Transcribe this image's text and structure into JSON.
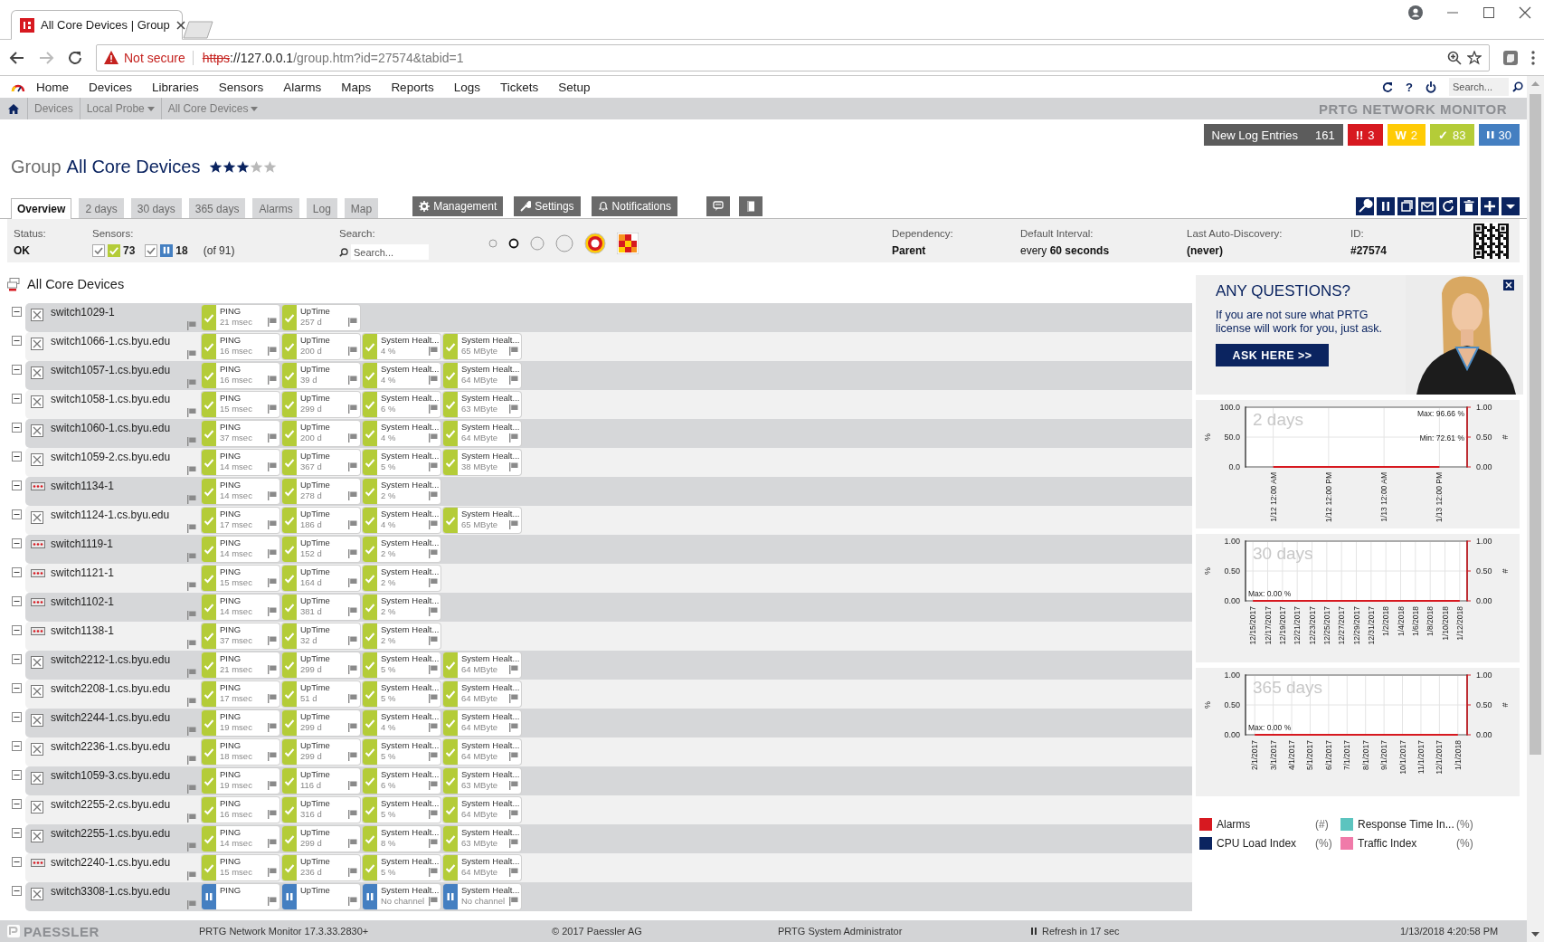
{
  "browser": {
    "tab": {
      "title": "All Core Devices | Group"
    },
    "not_secure": "Not secure",
    "url": {
      "scheme": "https",
      "host": "://127.0.0.1",
      "path": "/group.htm?id=27574&tabid=1"
    }
  },
  "menu": {
    "items": [
      "Home",
      "Devices",
      "Libraries",
      "Sensors",
      "Alarms",
      "Maps",
      "Reports",
      "Logs",
      "Tickets",
      "Setup"
    ],
    "help": "?",
    "search": {
      "placeholder": "Search..."
    }
  },
  "breadcrumb": {
    "items": [
      {
        "label": "Devices",
        "dropdown": false
      },
      {
        "label": "Local Probe",
        "dropdown": true
      },
      {
        "label": "All Core Devices",
        "dropdown": true
      }
    ],
    "product": "PRTG NETWORK MONITOR"
  },
  "badges": [
    {
      "kind": "log",
      "label": "New Log Entries",
      "count": "161",
      "color": "#5c5c5c"
    },
    {
      "kind": "down",
      "symbol": "!!",
      "count": "3",
      "color": "#d71920"
    },
    {
      "kind": "warning",
      "symbol": "W",
      "count": "2",
      "color": "#ffcb05"
    },
    {
      "kind": "up",
      "symbol": "✓",
      "count": "83",
      "color": "#b4cc38"
    },
    {
      "kind": "paused",
      "count": "30",
      "color": "#447fc1"
    }
  ],
  "page": {
    "type": "Group",
    "title": "All Core Devices",
    "stars": 3
  },
  "tabs": [
    {
      "label": "Overview",
      "selected": true
    },
    {
      "label": "2 days",
      "selected": false
    },
    {
      "label": "30 days",
      "selected": false
    },
    {
      "label": "365 days",
      "selected": false
    },
    {
      "label": "Alarms",
      "selected": false
    },
    {
      "label": "Log",
      "selected": false
    },
    {
      "label": "Map",
      "selected": false
    }
  ],
  "actions": [
    {
      "kind": "management",
      "label": "Management"
    },
    {
      "kind": "settings",
      "label": "Settings"
    },
    {
      "kind": "notifications",
      "label": "Notifications"
    },
    {
      "kind": "comments"
    },
    {
      "kind": "history"
    }
  ],
  "toolbar": [
    {
      "kind": "edit"
    },
    {
      "kind": "pause"
    },
    {
      "kind": "clone"
    },
    {
      "kind": "email"
    },
    {
      "kind": "rescan"
    },
    {
      "kind": "delete"
    },
    {
      "kind": "add"
    },
    {
      "kind": "more"
    }
  ],
  "info": {
    "status": {
      "label": "Status:",
      "value": "OK"
    },
    "sensors": {
      "label": "Sensors:",
      "filters": [
        {
          "kind": "up",
          "checked": true,
          "count": "73"
        },
        {
          "kind": "paused",
          "checked": true,
          "count": "18"
        }
      ],
      "total": "(of 91)"
    },
    "search": {
      "label": "Search:",
      "placeholder": "Search..."
    },
    "dependency": {
      "label": "Dependency:",
      "value": "Parent"
    },
    "interval": {
      "label": "Default Interval:",
      "value": "every **60 seconds**"
    },
    "discovery": {
      "label": "Last Auto-Discovery:",
      "value": "(never)"
    },
    "id": {
      "label": "ID:",
      "value": "#27574"
    }
  },
  "tree": {
    "title": "All Core Devices",
    "devices": [
      {
        "name": "switch1029-1",
        "kind": "server",
        "expanded": true,
        "sensors": [
          {
            "name": "PING",
            "value": "21 msec",
            "paused": false
          },
          {
            "name": "UpTime",
            "value": "257 d",
            "paused": false
          }
        ]
      },
      {
        "name": "switch1066-1.cs.byu.edu",
        "kind": "server",
        "expanded": true,
        "sensors": [
          {
            "name": "PING",
            "value": "16 msec",
            "paused": false
          },
          {
            "name": "UpTime",
            "value": "200 d",
            "paused": false
          },
          {
            "name": "System Healt...",
            "value": "4 %",
            "paused": false
          },
          {
            "name": "System Healt...",
            "value": "65 MByte",
            "paused": false
          }
        ]
      },
      {
        "name": "switch1057-1.cs.byu.edu",
        "kind": "server",
        "expanded": true,
        "sensors": [
          {
            "name": "PING",
            "value": "16 msec",
            "paused": false
          },
          {
            "name": "UpTime",
            "value": "39 d",
            "paused": false
          },
          {
            "name": "System Healt...",
            "value": "4 %",
            "paused": false
          },
          {
            "name": "System Healt...",
            "value": "64 MByte",
            "paused": false
          }
        ]
      },
      {
        "name": "switch1058-1.cs.byu.edu",
        "kind": "server",
        "expanded": true,
        "sensors": [
          {
            "name": "PING",
            "value": "15 msec",
            "paused": false
          },
          {
            "name": "UpTime",
            "value": "299 d",
            "paused": false
          },
          {
            "name": "System Healt...",
            "value": "6 %",
            "paused": false
          },
          {
            "name": "System Healt...",
            "value": "63 MByte",
            "paused": false
          }
        ]
      },
      {
        "name": "switch1060-1.cs.byu.edu",
        "kind": "server",
        "expanded": true,
        "sensors": [
          {
            "name": "PING",
            "value": "37 msec",
            "paused": false
          },
          {
            "name": "UpTime",
            "value": "200 d",
            "paused": false
          },
          {
            "name": "System Healt...",
            "value": "4 %",
            "paused": false
          },
          {
            "name": "System Healt...",
            "value": "64 MByte",
            "paused": false
          }
        ]
      },
      {
        "name": "switch1059-2.cs.byu.edu",
        "kind": "server",
        "expanded": true,
        "sensors": [
          {
            "name": "PING",
            "value": "14 msec",
            "paused": false
          },
          {
            "name": "UpTime",
            "value": "367 d",
            "paused": false
          },
          {
            "name": "System Healt...",
            "value": "5 %",
            "paused": false
          },
          {
            "name": "System Healt...",
            "value": "38 MByte",
            "paused": false
          }
        ]
      },
      {
        "name": "switch1134-1",
        "kind": "switch",
        "expanded": true,
        "sensors": [
          {
            "name": "PING",
            "value": "14 msec",
            "paused": false
          },
          {
            "name": "UpTime",
            "value": "278 d",
            "paused": false
          },
          {
            "name": "System Healt...",
            "value": "2 %",
            "paused": false
          }
        ]
      },
      {
        "name": "switch1124-1.cs.byu.edu",
        "kind": "server",
        "expanded": true,
        "sensors": [
          {
            "name": "PING",
            "value": "17 msec",
            "paused": false
          },
          {
            "name": "UpTime",
            "value": "186 d",
            "paused": false
          },
          {
            "name": "System Healt...",
            "value": "4 %",
            "paused": false
          },
          {
            "name": "System Healt...",
            "value": "65 MByte",
            "paused": false
          }
        ]
      },
      {
        "name": "switch1119-1",
        "kind": "switch",
        "expanded": true,
        "sensors": [
          {
            "name": "PING",
            "value": "14 msec",
            "paused": false
          },
          {
            "name": "UpTime",
            "value": "152 d",
            "paused": false
          },
          {
            "name": "System Healt...",
            "value": "2 %",
            "paused": false
          }
        ]
      },
      {
        "name": "switch1121-1",
        "kind": "switch",
        "expanded": true,
        "sensors": [
          {
            "name": "PING",
            "value": "15 msec",
            "paused": false
          },
          {
            "name": "UpTime",
            "value": "164 d",
            "paused": false
          },
          {
            "name": "System Healt...",
            "value": "2 %",
            "paused": false
          }
        ]
      },
      {
        "name": "switch1102-1",
        "kind": "switch",
        "expanded": true,
        "sensors": [
          {
            "name": "PING",
            "value": "14 msec",
            "paused": false
          },
          {
            "name": "UpTime",
            "value": "381 d",
            "paused": false
          },
          {
            "name": "System Healt...",
            "value": "2 %",
            "paused": false
          }
        ]
      },
      {
        "name": "switch1138-1",
        "kind": "switch",
        "expanded": true,
        "sensors": [
          {
            "name": "PING",
            "value": "37 msec",
            "paused": false
          },
          {
            "name": "UpTime",
            "value": "32 d",
            "paused": false
          },
          {
            "name": "System Healt...",
            "value": "2 %",
            "paused": false
          }
        ]
      },
      {
        "name": "switch2212-1.cs.byu.edu",
        "kind": "server",
        "expanded": true,
        "sensors": [
          {
            "name": "PING",
            "value": "21 msec",
            "paused": false
          },
          {
            "name": "UpTime",
            "value": "299 d",
            "paused": false
          },
          {
            "name": "System Healt...",
            "value": "5 %",
            "paused": false
          },
          {
            "name": "System Healt...",
            "value": "64 MByte",
            "paused": false
          }
        ]
      },
      {
        "name": "switch2208-1.cs.byu.edu",
        "kind": "server",
        "expanded": true,
        "sensors": [
          {
            "name": "PING",
            "value": "17 msec",
            "paused": false
          },
          {
            "name": "UpTime",
            "value": "51 d",
            "paused": false
          },
          {
            "name": "System Healt...",
            "value": "5 %",
            "paused": false
          },
          {
            "name": "System Healt...",
            "value": "64 MByte",
            "paused": false
          }
        ]
      },
      {
        "name": "switch2244-1.cs.byu.edu",
        "kind": "server",
        "expanded": true,
        "sensors": [
          {
            "name": "PING",
            "value": "19 msec",
            "paused": false
          },
          {
            "name": "UpTime",
            "value": "299 d",
            "paused": false
          },
          {
            "name": "System Healt...",
            "value": "4 %",
            "paused": false
          },
          {
            "name": "System Healt...",
            "value": "64 MByte",
            "paused": false
          }
        ]
      },
      {
        "name": "switch2236-1.cs.byu.edu",
        "kind": "server",
        "expanded": true,
        "sensors": [
          {
            "name": "PING",
            "value": "18 msec",
            "paused": false
          },
          {
            "name": "UpTime",
            "value": "299 d",
            "paused": false
          },
          {
            "name": "System Healt...",
            "value": "5 %",
            "paused": false
          },
          {
            "name": "System Healt...",
            "value": "64 MByte",
            "paused": false
          }
        ]
      },
      {
        "name": "switch1059-3.cs.byu.edu",
        "kind": "server",
        "expanded": true,
        "sensors": [
          {
            "name": "PING",
            "value": "19 msec",
            "paused": false
          },
          {
            "name": "UpTime",
            "value": "116 d",
            "paused": false
          },
          {
            "name": "System Healt...",
            "value": "6 %",
            "paused": false
          },
          {
            "name": "System Healt...",
            "value": "63 MByte",
            "paused": false
          }
        ]
      },
      {
        "name": "switch2255-2.cs.byu.edu",
        "kind": "server",
        "expanded": true,
        "sensors": [
          {
            "name": "PING",
            "value": "16 msec",
            "paused": false
          },
          {
            "name": "UpTime",
            "value": "316 d",
            "paused": false
          },
          {
            "name": "System Healt...",
            "value": "5 %",
            "paused": false
          },
          {
            "name": "System Healt...",
            "value": "64 MByte",
            "paused": false
          }
        ]
      },
      {
        "name": "switch2255-1.cs.byu.edu",
        "kind": "server",
        "expanded": true,
        "sensors": [
          {
            "name": "PING",
            "value": "14 msec",
            "paused": false
          },
          {
            "name": "UpTime",
            "value": "299 d",
            "paused": false
          },
          {
            "name": "System Healt...",
            "value": "8 %",
            "paused": false
          },
          {
            "name": "System Healt...",
            "value": "63 MByte",
            "paused": false
          }
        ]
      },
      {
        "name": "switch2240-1.cs.byu.edu",
        "kind": "switch",
        "expanded": true,
        "sensors": [
          {
            "name": "PING",
            "value": "15 msec",
            "paused": false
          },
          {
            "name": "UpTime",
            "value": "236 d",
            "paused": false
          },
          {
            "name": "System Healt...",
            "value": "5 %",
            "paused": false
          },
          {
            "name": "System Healt...",
            "value": "64 MByte",
            "paused": false
          }
        ]
      },
      {
        "name": "switch3308-1.cs.byu.edu",
        "kind": "server",
        "expanded": true,
        "sensors": [
          {
            "name": "PING",
            "paused": true
          },
          {
            "name": "UpTime",
            "paused": true
          },
          {
            "name": "System Healt...",
            "value": "No channel",
            "paused": true
          },
          {
            "name": "System Healt...",
            "value": "No channel",
            "paused": true
          }
        ]
      }
    ]
  },
  "side": {
    "ad": {
      "title": "ANY QUESTIONS?",
      "text": "If you are not sure what PRTG license will work for you, just ask.",
      "button": "ASK HERE >>"
    },
    "charts": [
      {
        "chart_data": {
          "type": "line",
          "title": "2 days",
          "ylabel": "%",
          "categories": [
            "1/12 12:00 AM",
            "1/12 12:00 PM",
            "1/13 12:00 AM",
            "1/13 12:00 PM"
          ],
          "ylim": [
            0,
            100
          ],
          "yticks": [
            {
              "value": 0,
              "label": "0.0"
            },
            {
              "value": 50,
              "label": "50.0"
            },
            {
              "value": 100,
              "label": "100.0"
            }
          ],
          "grid": true,
          "series": [
            {
              "color": "#d71920",
              "values": [
                0,
                0,
                0,
                0
              ]
            }
          ],
          "annotations": [
            "Max: 96.66 %",
            "Min: 72.61 %"
          ]
        },
        "right_axis": {
          "label": "#",
          "ticks": [
            "1.00",
            "0.50",
            "0.00"
          ]
        }
      },
      {
        "chart_data": {
          "type": "line",
          "title": "30 days",
          "ylabel": "%",
          "categories": [
            "12/15/2017",
            "12/17/2017",
            "12/19/2017",
            "12/21/2017",
            "12/23/2017",
            "12/25/2017",
            "12/27/2017",
            "12/29/2017",
            "12/31/2017",
            "1/2/2018",
            "1/4/2018",
            "1/6/2018",
            "1/8/2018",
            "1/10/2018",
            "1/12/2018"
          ],
          "ylim": [
            0,
            1
          ],
          "yticks": [
            {
              "value": 0,
              "label": "0.00"
            },
            {
              "value": 0.5,
              "label": "0.50"
            },
            {
              "value": 1,
              "label": "1.00"
            }
          ],
          "grid": true,
          "series": [
            {
              "color": "#d71920",
              "values": [
                0,
                0,
                0,
                0,
                0,
                0,
                0,
                0,
                0,
                0,
                0,
                0,
                0,
                0,
                0
              ]
            }
          ],
          "annotations": [
            "Max: 0.00 %"
          ]
        },
        "right_axis": {
          "label": "#",
          "ticks": [
            "1.00",
            "0.50",
            "0.00"
          ]
        }
      },
      {
        "chart_data": {
          "type": "line",
          "title": "365 days",
          "ylabel": "%",
          "categories": [
            "2/1/2017",
            "3/1/2017",
            "4/1/2017",
            "5/1/2017",
            "6/1/2017",
            "7/1/2017",
            "8/1/2017",
            "9/1/2017",
            "10/1/2017",
            "11/1/2017",
            "12/1/2017",
            "1/1/2018"
          ],
          "ylim": [
            0,
            1
          ],
          "yticks": [
            {
              "value": 0,
              "label": "0.00"
            },
            {
              "value": 0.5,
              "label": "0.50"
            },
            {
              "value": 1,
              "label": "1.00"
            }
          ],
          "grid": true,
          "series": [
            {
              "color": "#d71920",
              "values": [
                0,
                0,
                0,
                0,
                0,
                0,
                0,
                0,
                0,
                0,
                0,
                0
              ]
            }
          ],
          "annotations": [
            "Max: 0.00 %"
          ]
        },
        "right_axis": {
          "label": "#",
          "ticks": [
            "1.00",
            "0.50",
            "0.00"
          ]
        }
      }
    ],
    "legend": [
      {
        "label": "Alarms",
        "unit": "(#)",
        "color": "#d71920"
      },
      {
        "label": "Response Time In...",
        "unit": "(%)",
        "color": "#5cc4bf"
      },
      {
        "label": "CPU Load Index",
        "unit": "(%)",
        "color": "#0b2460"
      },
      {
        "label": "Traffic Index",
        "unit": "(%)",
        "color": "#f07aa9"
      }
    ]
  },
  "footer": {
    "brand": "PAESSLER",
    "version": "PRTG Network Monitor 17.3.33.2830+",
    "copyright": "© 2017 Paessler AG",
    "user": "PRTG System Administrator",
    "refresh": "Refresh in 17 sec",
    "datetime": "1/13/2018 4:20:58 PM"
  }
}
